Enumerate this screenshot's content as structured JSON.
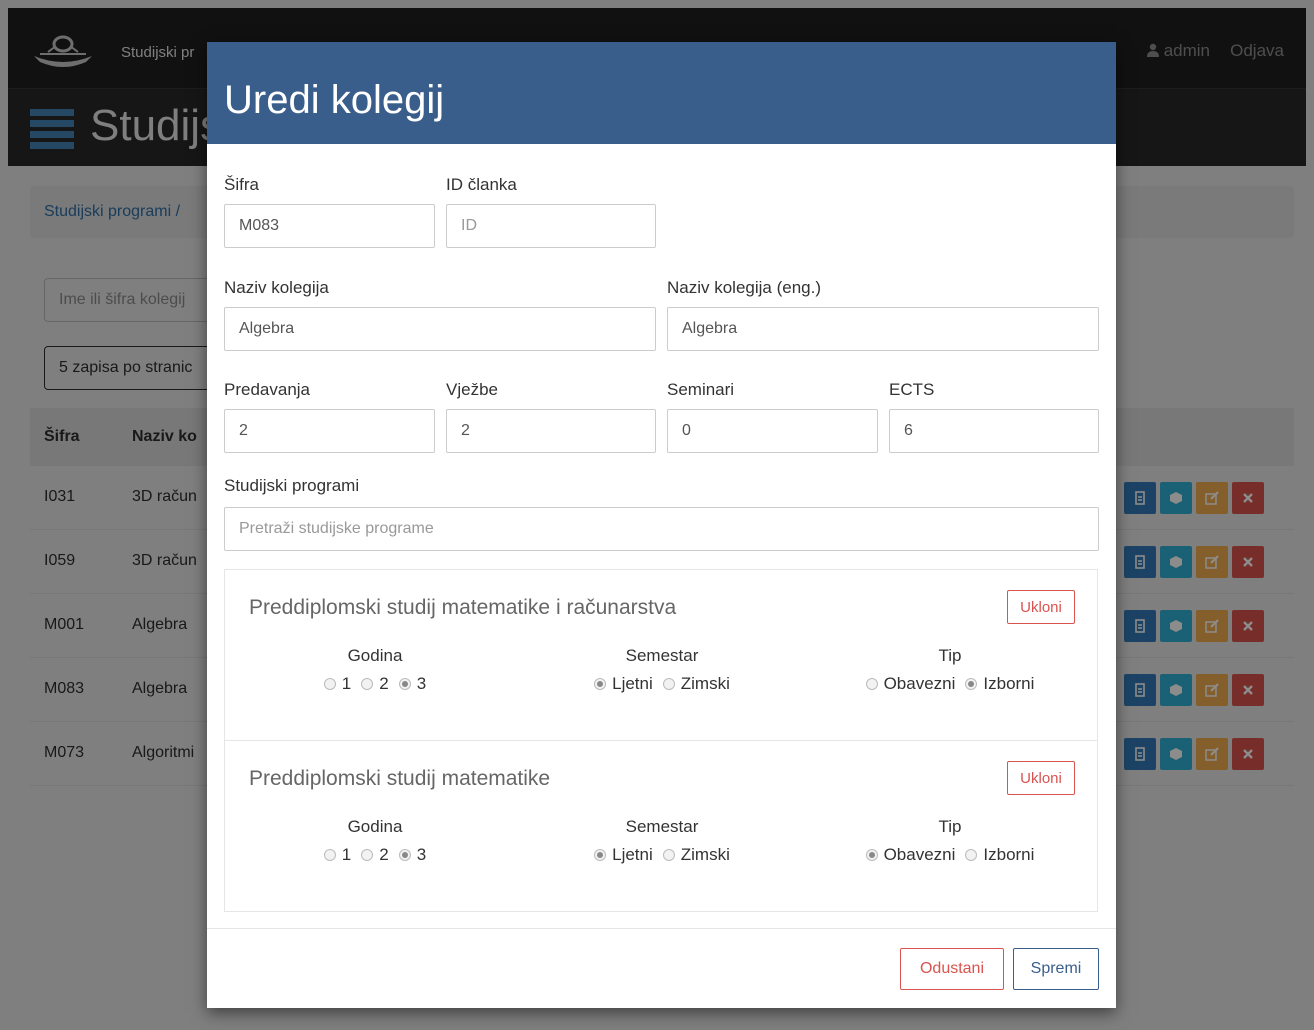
{
  "navbar": {
    "brand": "Studijski pr",
    "user": "admin",
    "logout": "Odjava",
    "icons": {
      "logo": "ship-logo",
      "user": "user-icon"
    }
  },
  "page": {
    "title": "Studijs",
    "breadcrumb": "Studijski programi /",
    "search_placeholder": "Ime ili šifra kolegij",
    "per_page": "5 zapisa po stranic",
    "columns": [
      "Šifra",
      "Naziv ko"
    ],
    "rows": [
      {
        "code": "I031",
        "name": "3D račun"
      },
      {
        "code": "I059",
        "name": "3D račun"
      },
      {
        "code": "M001",
        "name": "Algebra"
      },
      {
        "code": "M083",
        "name": "Algebra"
      },
      {
        "code": "M073",
        "name": "Algoritmi"
      }
    ]
  },
  "modal": {
    "title": "Uredi kolegij",
    "fields": {
      "code_label": "Šifra",
      "code_value": "M083",
      "article_label": "ID članka",
      "article_placeholder": "ID",
      "name_label": "Naziv kolegija",
      "name_value": "Algebra",
      "name_en_label": "Naziv kolegija (eng.)",
      "name_en_value": "Algebra",
      "lectures_label": "Predavanja",
      "lectures_value": "2",
      "exercises_label": "Vježbe",
      "exercises_value": "2",
      "seminars_label": "Seminari",
      "seminars_value": "0",
      "ects_label": "ECTS",
      "ects_value": "6",
      "programs_label": "Studijski programi",
      "programs_placeholder": "Pretraži studijske programe"
    },
    "labels": {
      "year": "Godina",
      "semester": "Semestar",
      "type": "Tip",
      "year_options": [
        "1",
        "2",
        "3"
      ],
      "semester_options": [
        "Ljetni",
        "Zimski"
      ],
      "type_options": [
        "Obavezni",
        "Izborni"
      ]
    },
    "programs": [
      {
        "title": "Preddiplomski studij matematike i računarstva",
        "remove": "Ukloni"
      },
      {
        "title": "Preddiplomski studij matematike",
        "remove": "Ukloni"
      }
    ],
    "cancel": "Odustani",
    "save": "Spremi"
  }
}
